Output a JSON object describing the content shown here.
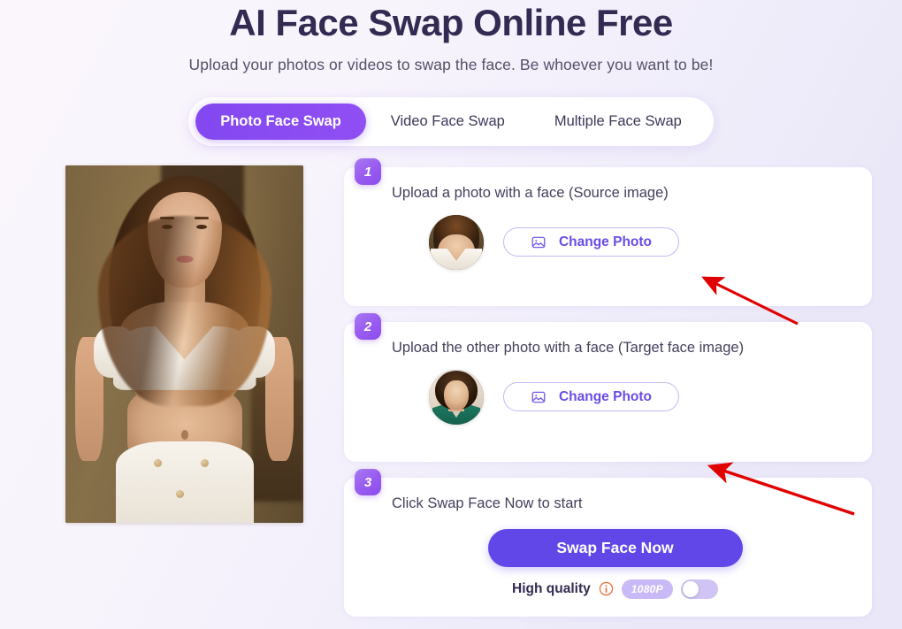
{
  "hero": {
    "title": "AI Face Swap Online Free",
    "subtitle": "Upload your photos or videos to swap the face. Be whoever you want to be!"
  },
  "tabs": [
    {
      "label": "Photo Face Swap",
      "active": true
    },
    {
      "label": "Video Face Swap",
      "active": false
    },
    {
      "label": "Multiple Face Swap",
      "active": false
    }
  ],
  "preview": {
    "alt": "Generated portrait preview of a woman in a white crop top"
  },
  "steps": [
    {
      "number": "1",
      "title": "Upload a photo with a face (Source image)",
      "button_label": "Change Photo",
      "icon": "image-icon",
      "avatar": "source-face-thumbnail"
    },
    {
      "number": "2",
      "title": "Upload the other photo with a face (Target face image)",
      "button_label": "Change Photo",
      "icon": "image-icon",
      "avatar": "target-face-thumbnail"
    },
    {
      "number": "3",
      "title": "Click Swap Face Now to start",
      "button_label": "Swap Face Now",
      "quality_label": "High quality",
      "quality_badge": "1080P",
      "quality_toggle": "off",
      "info_icon": "info-icon"
    }
  ],
  "annotations": [
    {
      "name": "arrow-to-source-change-photo",
      "color": "#e00000"
    },
    {
      "name": "arrow-to-target-change-photo",
      "color": "#e00000"
    }
  ],
  "colors": {
    "accent": "#6247e8",
    "tab_active": "#8a4bf2",
    "title": "#332b52",
    "badge_purple": "#9a5df0",
    "annotation_red": "#e00000",
    "quality_badge_bg": "#c9b9f6",
    "page_bg_start": "#faf6fc",
    "page_bg_end": "#e9e7f8"
  }
}
